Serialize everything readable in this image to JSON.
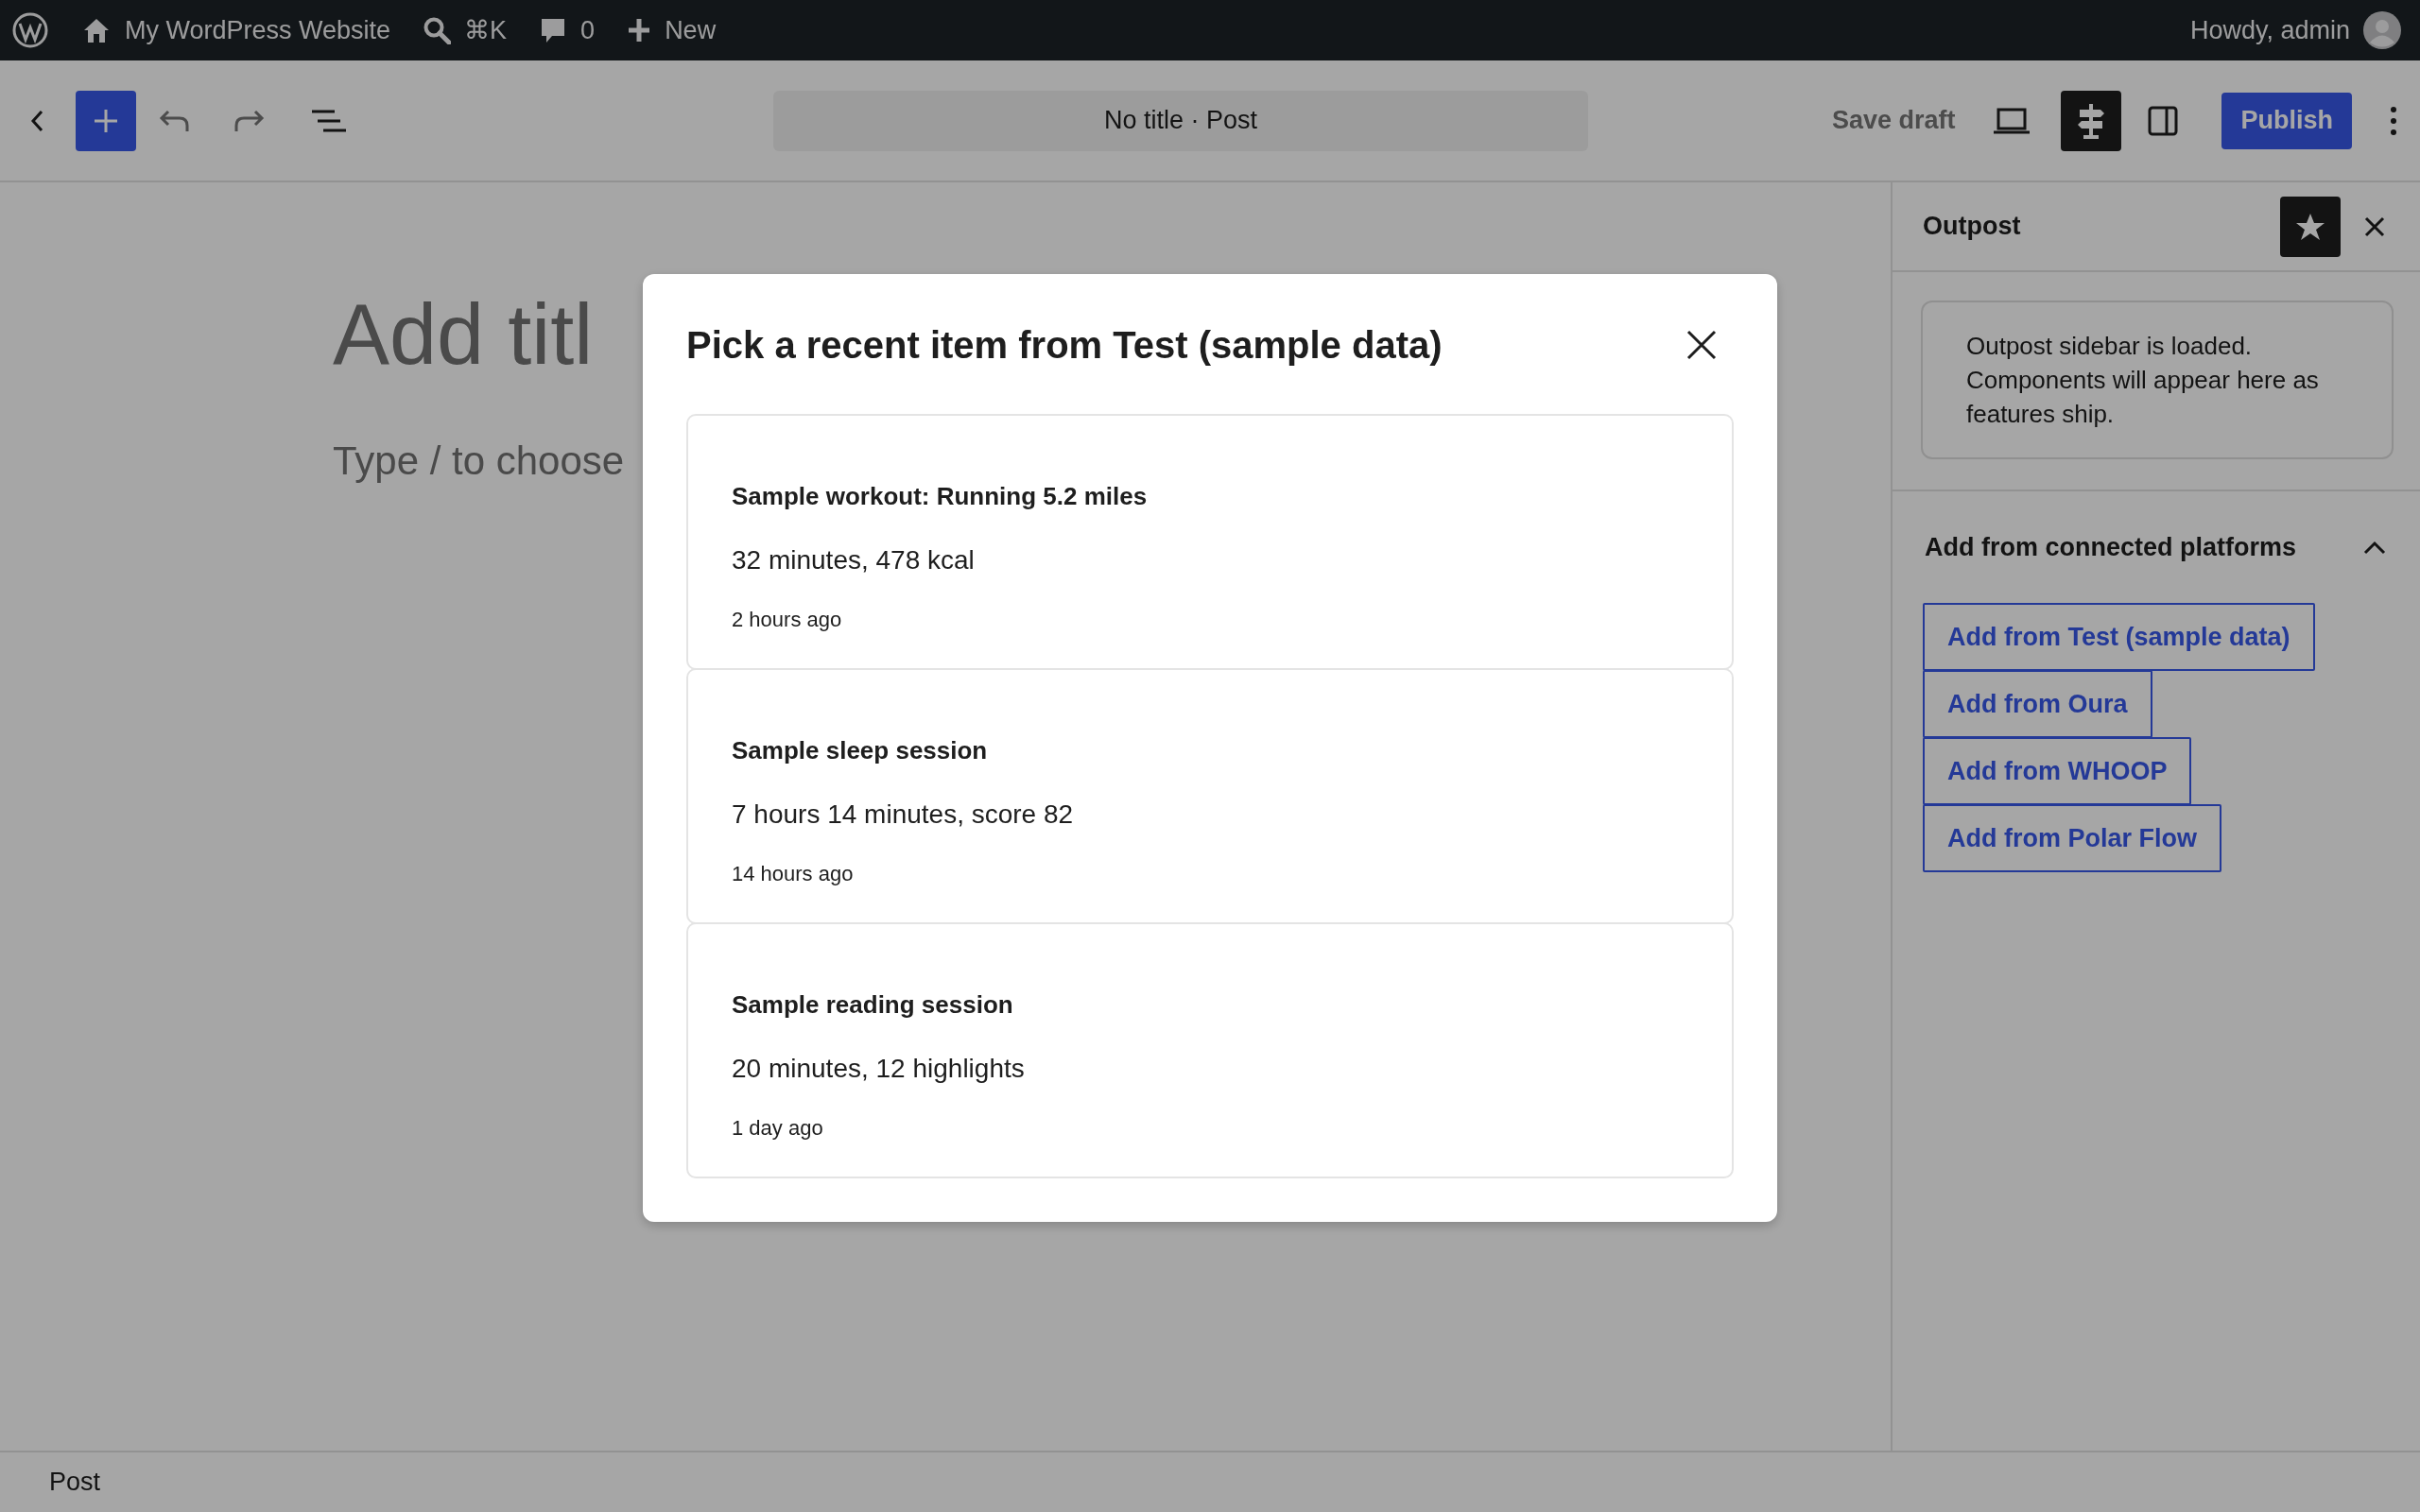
{
  "admin_bar": {
    "site_name": "My WordPress Website",
    "search_shortcut": "⌘K",
    "comments_count": "0",
    "new_label": "New",
    "greeting": "Howdy, admin"
  },
  "toolbar": {
    "document_title": "No title · Post",
    "save_draft": "Save draft",
    "publish": "Publish",
    "plugin_panel_selected": true
  },
  "editor": {
    "title_text": "Add titl",
    "body_text": "Type / to choose"
  },
  "sidebar": {
    "title": "Outpost",
    "pinned": true,
    "notice": "Outpost sidebar is loaded. Components will appear here as features ship.",
    "section": {
      "title": "Add from connected platforms",
      "expanded": true,
      "buttons": [
        "Add from Test (sample data)",
        "Add from Oura",
        "Add from WHOOP",
        "Add from Polar Flow"
      ]
    }
  },
  "modal": {
    "title": "Pick a recent item from Test (sample data)",
    "items": [
      {
        "title": "Sample workout: Running 5.2 miles",
        "detail": "32 minutes, 478 kcal",
        "time": "2 hours ago"
      },
      {
        "title": "Sample sleep session",
        "detail": "7 hours 14 minutes, score 82",
        "time": "14 hours ago"
      },
      {
        "title": "Sample reading session",
        "detail": "20 minutes, 12 highlights",
        "time": "1 day ago"
      }
    ]
  },
  "footer": {
    "breadcrumb": "Post"
  }
}
